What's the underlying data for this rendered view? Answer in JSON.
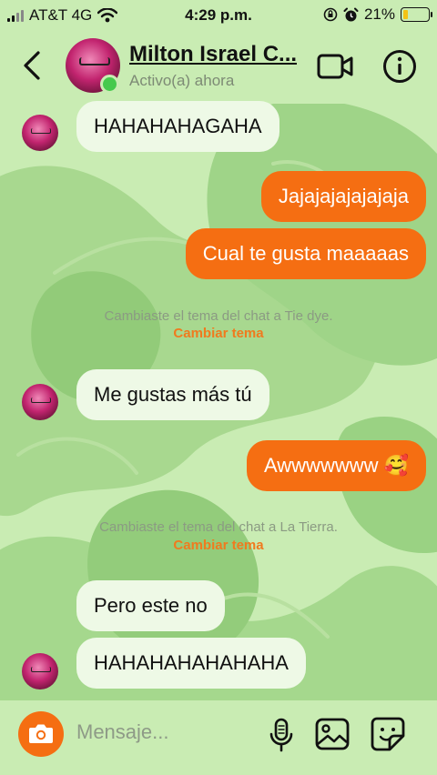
{
  "status_bar": {
    "carrier": "AT&T 4G",
    "time": "4:29 p.m.",
    "battery": "21%",
    "battery_level": 0.21
  },
  "header": {
    "contact_name": "Milton Israel C...",
    "presence": "Activo(a) ahora",
    "icons": [
      "back-chevron-icon",
      "video-camera-icon",
      "info-icon"
    ]
  },
  "messages": [
    {
      "side": "incoming",
      "text": "HAHAHAHAGAHA"
    },
    {
      "side": "outgoing",
      "text": "Jajajajajajajaja"
    },
    {
      "side": "outgoing",
      "text": "Cual te gusta maaaaas"
    },
    {
      "side": "incoming",
      "text": "Me gustas más tú"
    },
    {
      "side": "outgoing",
      "text": "Awwwwwww 🥰"
    },
    {
      "side": "incoming",
      "text": "Pero este no"
    },
    {
      "side": "incoming",
      "text": "HAHAHAHAHAHAHA"
    }
  ],
  "notices": [
    {
      "text": "Cambiaste el tema del chat a Tie dye.",
      "action": "Cambiar tema"
    },
    {
      "text": "Cambiaste el tema del chat a La Tierra.",
      "action": "Cambiar tema"
    }
  ],
  "composer": {
    "placeholder": "Mensaje...",
    "icons": [
      "camera-icon",
      "microphone-icon",
      "gallery-icon",
      "sticker-icon"
    ]
  },
  "colors": {
    "background": "#c9ecb3",
    "outgoing_bubble": "#f56e12",
    "incoming_bubble": "#eef9e6",
    "accent_link": "#f07a1e"
  }
}
